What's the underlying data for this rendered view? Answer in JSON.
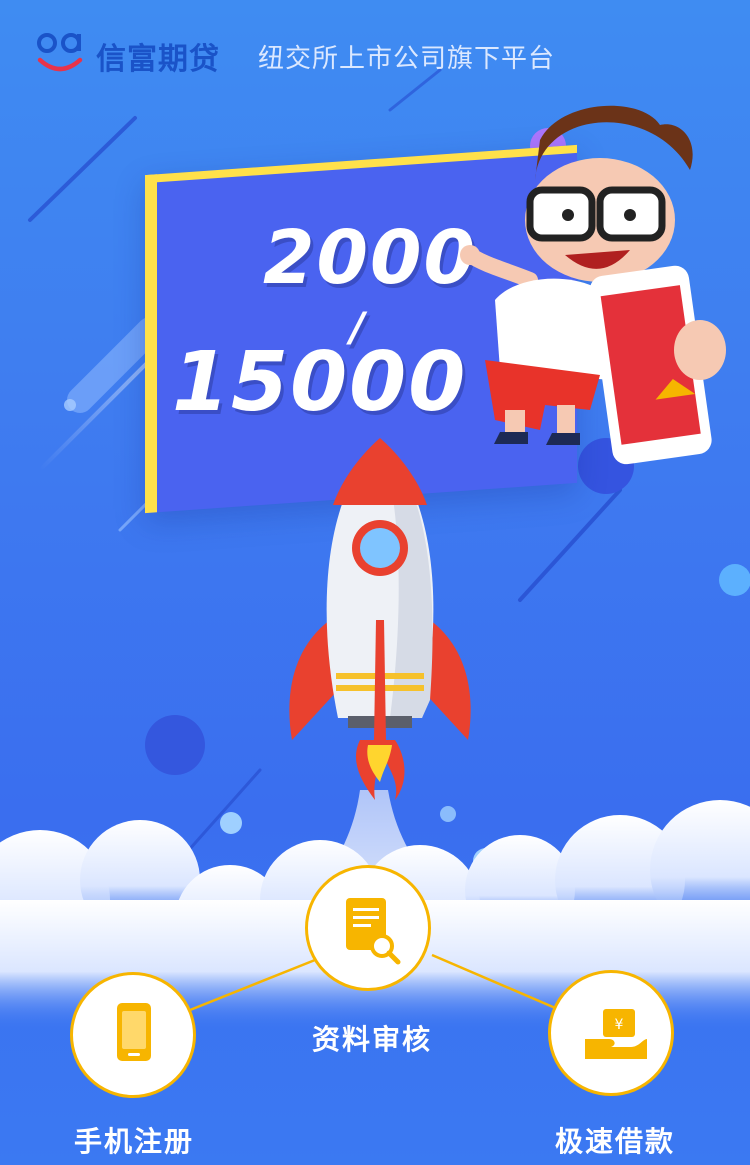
{
  "header": {
    "brand_name": "信富期贷",
    "slogan": "纽交所上市公司旗下平台",
    "logo_icon": "smile-logo-icon"
  },
  "banner": {
    "amount_top": "2000",
    "amount_separator": "/",
    "amount_bottom": "15000"
  },
  "steps": [
    {
      "label": "手机注册",
      "icon": "phone-icon"
    },
    {
      "label": "资料审核",
      "icon": "document-search-icon"
    },
    {
      "label": "极速借款",
      "icon": "money-hand-icon"
    }
  ],
  "colors": {
    "background_blue": "#3f7cf0",
    "brand_blue": "#1a53c8",
    "accent_yellow": "#f7b500",
    "rocket_red": "#e9412f",
    "board_blue": "#4a63f0"
  }
}
